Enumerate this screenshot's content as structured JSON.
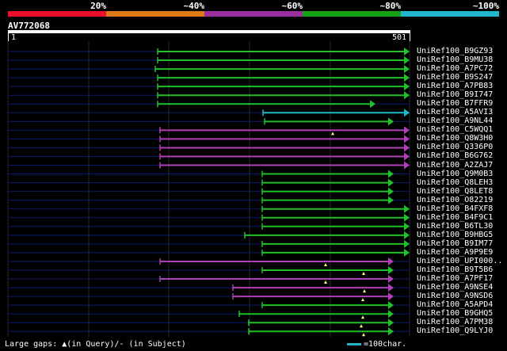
{
  "legend": {
    "labels": [
      "20%",
      "~40%",
      "~60%",
      "~80%",
      "~100%"
    ],
    "colors": [
      "#e8102a",
      "#e07a18",
      "#9b2fa0",
      "#16a117",
      "#1fb7c9"
    ]
  },
  "query": {
    "id": "AV772068",
    "start": "1",
    "end": "501"
  },
  "colors": {
    "green": "#22c02a",
    "purple": "#b040b8",
    "cyan": "#1fb7c9",
    "background_line": "#0b1a6b",
    "gap_marker": "#ffff80"
  },
  "hits": [
    {
      "name": "UniRef100_B9GZ93",
      "start": 190,
      "end": 501,
      "color": "green",
      "gaps": []
    },
    {
      "name": "UniRef100_B9MU38",
      "start": 190,
      "end": 501,
      "color": "green",
      "gaps": []
    },
    {
      "name": "UniRef100_A7PC72",
      "start": 187,
      "end": 501,
      "color": "green",
      "gaps": []
    },
    {
      "name": "UniRef100_B9S247",
      "start": 190,
      "end": 501,
      "color": "green",
      "gaps": []
    },
    {
      "name": "UniRef100_A7PB83",
      "start": 190,
      "end": 501,
      "color": "green",
      "gaps": []
    },
    {
      "name": "UniRef100_B9I747",
      "start": 190,
      "end": 501,
      "color": "green",
      "gaps": []
    },
    {
      "name": "UniRef100_B7FFR9",
      "start": 190,
      "end": 458,
      "color": "green",
      "gaps": []
    },
    {
      "name": "UniRef100_A5AVI3",
      "start": 323,
      "end": 501,
      "color": "cyan",
      "gaps": []
    },
    {
      "name": "UniRef100_A9NL44",
      "start": 325,
      "end": 481,
      "color": "green",
      "gaps": []
    },
    {
      "name": "UniRef100_C5WQQ1",
      "start": 193,
      "end": 501,
      "color": "purple",
      "gaps": [
        411
      ]
    },
    {
      "name": "UniRef100_Q8W3H0",
      "start": 193,
      "end": 501,
      "color": "purple",
      "gaps": []
    },
    {
      "name": "UniRef100_Q336P0",
      "start": 193,
      "end": 501,
      "color": "purple",
      "gaps": []
    },
    {
      "name": "UniRef100_B6G762",
      "start": 193,
      "end": 501,
      "color": "purple",
      "gaps": []
    },
    {
      "name": "UniRef100_A2ZAJ7",
      "start": 193,
      "end": 501,
      "color": "purple",
      "gaps": []
    },
    {
      "name": "UniRef100_Q9M0B3",
      "start": 322,
      "end": 481,
      "color": "green",
      "gaps": []
    },
    {
      "name": "UniRef100_Q8LEH3",
      "start": 322,
      "end": 481,
      "color": "green",
      "gaps": []
    },
    {
      "name": "UniRef100_Q8LET8",
      "start": 322,
      "end": 481,
      "color": "green",
      "gaps": []
    },
    {
      "name": "UniRef100_O82219",
      "start": 322,
      "end": 481,
      "color": "green",
      "gaps": []
    },
    {
      "name": "UniRef100_B4FXF8",
      "start": 322,
      "end": 501,
      "color": "green",
      "gaps": []
    },
    {
      "name": "UniRef100_B4F9C1",
      "start": 322,
      "end": 501,
      "color": "green",
      "gaps": []
    },
    {
      "name": "UniRef100_B6TL30",
      "start": 322,
      "end": 501,
      "color": "green",
      "gaps": []
    },
    {
      "name": "UniRef100_B9HBG5",
      "start": 300,
      "end": 501,
      "color": "green",
      "gaps": []
    },
    {
      "name": "UniRef100_B9IM77",
      "start": 322,
      "end": 501,
      "color": "green",
      "gaps": []
    },
    {
      "name": "UniRef100_A9P9E9",
      "start": 322,
      "end": 501,
      "color": "green",
      "gaps": []
    },
    {
      "name": "UniRef100_UPI000..",
      "start": 193,
      "end": 481,
      "color": "purple",
      "gaps": [
        402
      ]
    },
    {
      "name": "UniRef100_B9T5B6",
      "start": 322,
      "end": 481,
      "color": "green",
      "gaps": [
        450
      ]
    },
    {
      "name": "UniRef100_A7PF17",
      "start": 193,
      "end": 481,
      "color": "purple",
      "gaps": [
        402
      ]
    },
    {
      "name": "UniRef100_A9NSE4",
      "start": 285,
      "end": 481,
      "color": "purple",
      "gaps": [
        451
      ]
    },
    {
      "name": "UniRef100_A9NSD6",
      "start": 285,
      "end": 481,
      "color": "purple",
      "gaps": [
        449
      ]
    },
    {
      "name": "UniRef100_A5APD4",
      "start": 322,
      "end": 481,
      "color": "green",
      "gaps": []
    },
    {
      "name": "UniRef100_B9GHQ5",
      "start": 293,
      "end": 481,
      "color": "green",
      "gaps": [
        449
      ]
    },
    {
      "name": "UniRef100_A7PM38",
      "start": 305,
      "end": 481,
      "color": "green",
      "gaps": [
        447
      ]
    },
    {
      "name": "UniRef100_Q9LYJ0",
      "start": 305,
      "end": 481,
      "color": "green",
      "gaps": [
        450
      ]
    }
  ],
  "footer": {
    "gaps_text": "Large gaps: ▲(in Query)/- (in Subject)",
    "scale_text": "=100char."
  }
}
